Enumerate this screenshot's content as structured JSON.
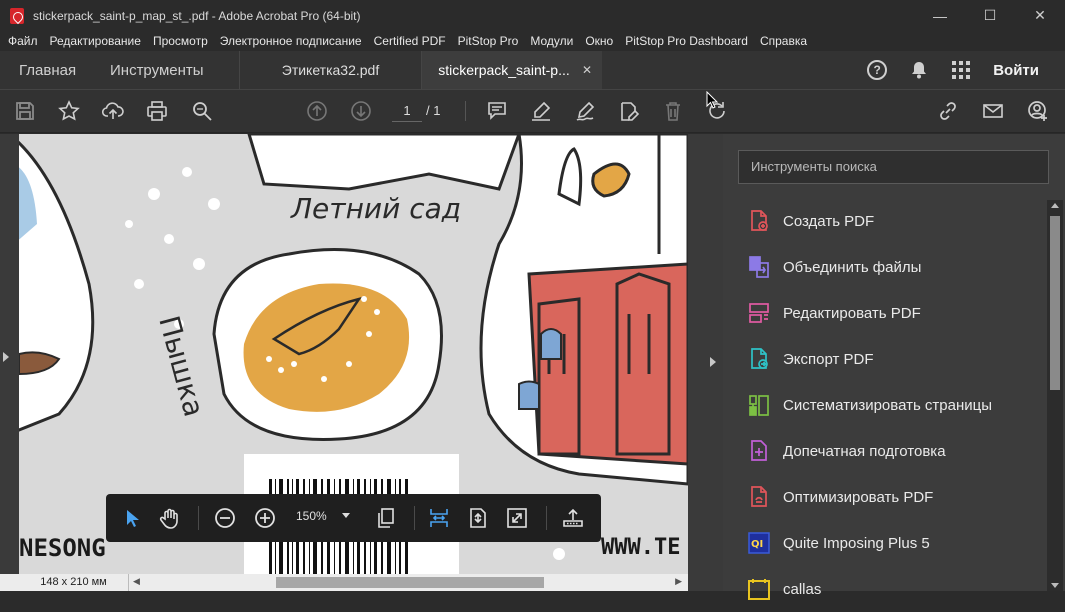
{
  "window": {
    "title": "stickerpack_saint-p_map_st_.pdf - Adobe Acrobat Pro (64-bit)",
    "minimize": "—",
    "maximize": "☐",
    "close": "✕"
  },
  "menu": [
    "Файл",
    "Редактирование",
    "Просмотр",
    "Электронное подписание",
    "Certified PDF",
    "PitStop Pro",
    "Модули",
    "Окно",
    "PitStop Pro Dashboard",
    "Справка"
  ],
  "tabs": {
    "home": "Главная",
    "tools": "Инструменты",
    "documents": [
      {
        "label": "Этикетка32.pdf",
        "active": false
      },
      {
        "label": "stickerpack_saint-p...",
        "active": true,
        "close": "✕"
      }
    ],
    "help_icon": "?",
    "sign_in": "Войти"
  },
  "toolbar": {
    "page_current": "1",
    "page_total": "/ 1",
    "icons": [
      "save-icon",
      "star-icon",
      "upload-icon",
      "print-icon",
      "find-icon",
      "prev-page-icon",
      "next-page-icon",
      "comment-icon",
      "highlight-icon",
      "sign-icon",
      "edit-pdf-icon",
      "delete-icon",
      "rotate-icon",
      "share-link-icon",
      "email-icon",
      "add-user-icon"
    ]
  },
  "document": {
    "sticker_texts": [
      "Летний сад",
      "Пышка",
      "NESONG",
      "WWW.TE"
    ],
    "page_size": "148 x 210 мм"
  },
  "floating_toolbar": {
    "zoom": "150%",
    "icons": [
      "select-icon",
      "hand-icon",
      "zoom-out-icon",
      "zoom-in-icon",
      "page-view-icon",
      "fit-width-icon",
      "fit-page-icon",
      "full-screen-icon",
      "read-mode-icon"
    ]
  },
  "panel": {
    "search_placeholder": "Инструменты поиска",
    "tools": [
      {
        "label": "Создать PDF",
        "icon": "create-pdf-icon",
        "color": "#e0555a"
      },
      {
        "label": "Объединить файлы",
        "icon": "combine-files-icon",
        "color": "#8c7ae6"
      },
      {
        "label": "Редактировать PDF",
        "icon": "edit-pdf-icon",
        "color": "#e25ba3"
      },
      {
        "label": "Экспорт PDF",
        "icon": "export-pdf-icon",
        "color": "#2ec2c7"
      },
      {
        "label": "Систематизировать страницы",
        "icon": "organize-pages-icon",
        "color": "#7cc043"
      },
      {
        "label": "Допечатная подготовка",
        "icon": "print-production-icon",
        "color": "#c05fd6"
      },
      {
        "label": "Оптимизировать PDF",
        "icon": "optimize-pdf-icon",
        "color": "#e0555a"
      },
      {
        "label": "Quite Imposing Plus 5",
        "icon": "quite-imposing-icon",
        "color": "#3a5bd9"
      },
      {
        "label": "callas",
        "icon": "callas-icon",
        "color": "#e8c41f"
      }
    ]
  },
  "colors": {
    "accent_blue": "#4aa3f0",
    "sticker_orange": "#e3a646",
    "sticker_red": "#d9665c"
  }
}
